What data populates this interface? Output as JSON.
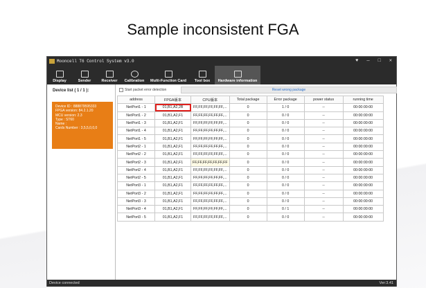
{
  "slide_title": "Sample inconsistent FGA",
  "app": {
    "title": "Mooncell T6 Control System v3.0",
    "window_controls": [
      "♥",
      "—",
      "□",
      "✕"
    ]
  },
  "toolbar": [
    {
      "label": "Display",
      "icon": "monitor-icon"
    },
    {
      "label": "Sender",
      "icon": "sender-icon"
    },
    {
      "label": "Receiver",
      "icon": "chip-icon"
    },
    {
      "label": "Calibration",
      "icon": "palette-icon"
    },
    {
      "label": "Multi-Function Card",
      "icon": "card-icon"
    },
    {
      "label": "Tool box",
      "icon": "toolbox-icon"
    },
    {
      "label": "Hardware information",
      "icon": "chart-icon"
    }
  ],
  "sidebar": {
    "title": "Device list ( 1 / 1 ):",
    "device_lines": [
      "Device ID : 888879595333",
      "FPGA version: 84.2.1.20",
      "MCU version: 2.3",
      "Type : ST60",
      "Name :",
      "Cards Number : 3,5,5,0,0,0"
    ]
  },
  "options": {
    "checkbox_label": "Start packet error detection",
    "reset_label": "Reset wrong package"
  },
  "table": {
    "headers": [
      "address",
      "FPGA版本",
      "CPU版本",
      "Total package",
      "Error package",
      "power status",
      "running time"
    ],
    "rows": [
      [
        "NetPort1 - 1",
        "01,B1,A2,2B",
        "FF,FF,FF,FF,FF,FF,...",
        "0",
        "1 / 0",
        "--",
        "00:00:00:00"
      ],
      [
        "NetPort1 - 2",
        "01,B1,A2,F1",
        "FF,FF,FF,FF,FF,FF,...",
        "0",
        "0 / 0",
        "--",
        "00:00:00:00"
      ],
      [
        "NetPort1 - 3",
        "01,B1,A2,F1",
        "FF,FF,FF,FF,FF,FF,...",
        "0",
        "0 / 0",
        "--",
        "00:00:00:00"
      ],
      [
        "NetPort1 - 4",
        "01,B1,A2,F1",
        "FF,FF,FF,FF,FF,FF,...",
        "0",
        "0 / 0",
        "--",
        "00:00:00:00"
      ],
      [
        "NetPort1 - 5",
        "01,B1,A2,F1",
        "FF,FF,FF,FF,FF,FF,...",
        "0",
        "0 / 0",
        "--",
        "00:00:00:00"
      ],
      [
        "NetPort2 - 1",
        "01,B1,A2,F1",
        "FF,FF,FF,FF,FF,FF,...",
        "0",
        "0 / 0",
        "--",
        "00:00:00:00"
      ],
      [
        "NetPort2 - 2",
        "01,B1,A2,F1",
        "FF,FF,FF,FF,FF,FF,...",
        "0",
        "0 / 0",
        "--",
        "00:00:00:00"
      ],
      [
        "NetPort2 - 3",
        "01,B1,A2,F1",
        "FF,FF,FF,FF,FF,FF,FF",
        "0",
        "0 / 0",
        "--",
        "00:00:00:00"
      ],
      [
        "NetPort2 - 4",
        "01,B1,A2,F1",
        "FF,FF,FF,FF,FF,FF,...",
        "0",
        "0 / 0",
        "--",
        "00:00:00:00"
      ],
      [
        "NetPort2 - 5",
        "01,B1,A2,F1",
        "FF,FF,FF,FF,FF,FF,...",
        "0",
        "0 / 0",
        "--",
        "00:00:00:00"
      ],
      [
        "NetPort3 - 1",
        "01,B1,A2,F1",
        "FF,FF,FF,FF,FF,FF,...",
        "0",
        "0 / 0",
        "--",
        "00:00:00:00"
      ],
      [
        "NetPort3 - 2",
        "01,B1,A2,F1",
        "FF,FF,FF,FF,FF,FF,...",
        "0",
        "0 / 0",
        "--",
        "00:00:00:00"
      ],
      [
        "NetPort3 - 3",
        "01,B1,A2,F1",
        "FF,FF,FF,FF,FF,FF,...",
        "0",
        "0 / 0",
        "--",
        "00:00:00:00"
      ],
      [
        "NetPort3 - 4",
        "01,B1,A2,F1",
        "FF,FF,FF,FF,FF,FF,...",
        "0",
        "0 / 1",
        "--",
        "00:00:00:00"
      ],
      [
        "NetPort3 - 5",
        "01,B1,A2,F1",
        "FF,FF,FF,FF,FF,FF,...",
        "0",
        "0 / 0",
        "--",
        "00:00:00:00"
      ]
    ]
  },
  "status": {
    "left": "Device connected",
    "version": "Ver:3.41"
  }
}
